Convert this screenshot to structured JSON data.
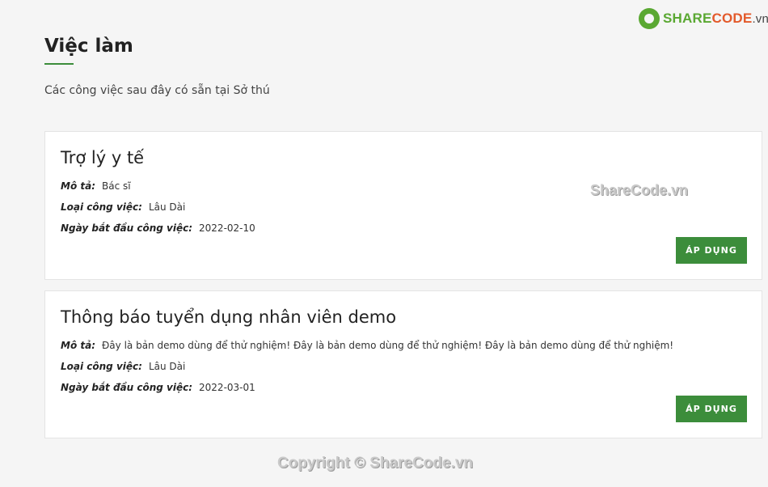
{
  "logo": {
    "part1": "SHARE",
    "part2": "CODE",
    "part3": ".vn"
  },
  "page": {
    "title": "Việc làm",
    "subtitle": "Các công việc sau đây có sẵn tại Sở thú"
  },
  "labels": {
    "description": "Mô tả:",
    "job_type": "Loại công việc:",
    "start_date": "Ngày bắt đầu công việc:"
  },
  "jobs": [
    {
      "title": "Trợ lý y tế",
      "description": "Bác sĩ",
      "job_type": "Lâu Dài",
      "start_date": "2022-02-10",
      "apply_label": "ÁP DỤNG"
    },
    {
      "title": "Thông báo tuyển dụng nhân viên demo",
      "description": "Đây là bản demo dùng để thử nghiệm! Đây là bản demo dùng để thử nghiệm! Đây là bản demo dùng để thử nghiệm!",
      "job_type": "Lâu Dài",
      "start_date": "2022-03-01",
      "apply_label": "ÁP DỤNG"
    }
  ],
  "watermarks": {
    "center": "ShareCode.vn",
    "footer": "Copyright © ShareCode.vn"
  },
  "colors": {
    "accent": "#3c8d3b",
    "logo_green": "#5aa832",
    "logo_orange": "#e35a2b"
  }
}
